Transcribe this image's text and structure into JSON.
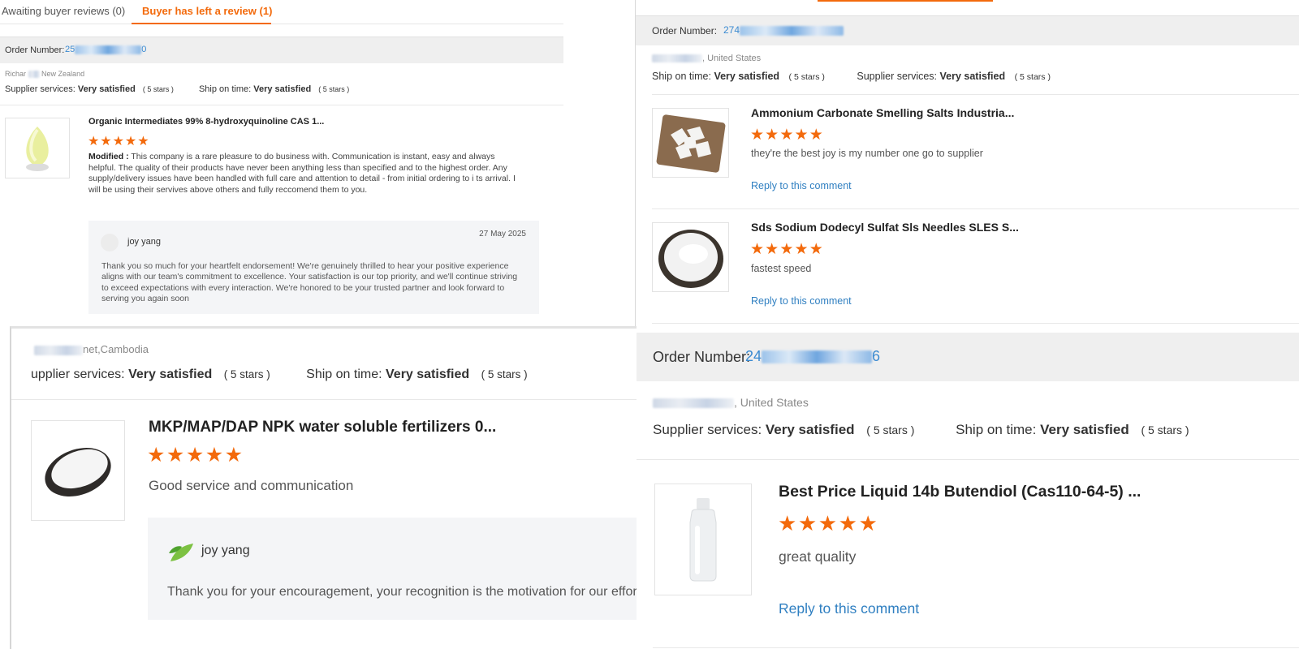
{
  "tabs": {
    "awaiting": "Awaiting buyer reviews (0)",
    "left": "Buyer has left a review (1)"
  },
  "labels": {
    "order_number": "Order Number:",
    "supplier_services": "Supplier services:",
    "ship_on_time": "Ship on time:",
    "very_satisfied": "Very satisfied",
    "five_stars": "( 5 stars )",
    "reply": "Reply to this comment",
    "stars_glyphs": "★★★★★"
  },
  "review1": {
    "order_prefix": "25",
    "order_suffix": "0",
    "buyer_first": "Richar",
    "buyer_country": "New Zealand",
    "product": "Organic Intermediates 99% 8-hydroxyquinoline CAS 1...",
    "modified_label": "Modified :",
    "comment": "This company is a rare pleasure to do business with. Communication is instant, easy and always helpful. The quality of their products have never been anything less than specified and to the highest order. Any supply/delivery issues have been handled with full care and attention to detail - from initial ordering to i ts arrival. I will be using their servives above others and fully reccomend them to you.",
    "reply_author": "joy yang",
    "reply_date": "27 May 2025",
    "reply_text": "Thank you so much for your heartfelt endorsement! We're genuinely thrilled to hear your positive experience aligns with our team's commitment to excellence. Your satisfaction is our top priority, and we'll continue striving to exceed expectations with every interaction. We're honored to be your trusted partner and look forward to serving you again soon"
  },
  "review2": {
    "order_prefix": "274",
    "buyer_country": ", United States",
    "items": [
      {
        "product": "Ammonium Carbonate Smelling Salts Industria...",
        "comment": "they're the best joy is my number one go to supplier"
      },
      {
        "product": "Sds Sodium Dodecyl Sulfat Sls Needles SLES S...",
        "comment": "fastest speed"
      }
    ]
  },
  "review3": {
    "buyer_location": "net,Cambodia",
    "supplier_partial": "upplier services:",
    "product": "MKP/MAP/DAP NPK water soluble fertilizers 0...",
    "comment": "Good service and communication",
    "reply_author": "joy yang",
    "reply_text": "Thank you for your encouragement, your recognition is the motivation for our effor"
  },
  "review4": {
    "order_prefix": "24",
    "order_suffix": "6",
    "buyer_country": ", United States",
    "product": "Best Price Liquid 14b Butendiol (Cas110-64-5) ...",
    "comment": "great quality"
  },
  "colors": {
    "accent_orange": "#f36a0c",
    "link_blue": "#2f7fc1",
    "order_bar": "#efefef"
  }
}
